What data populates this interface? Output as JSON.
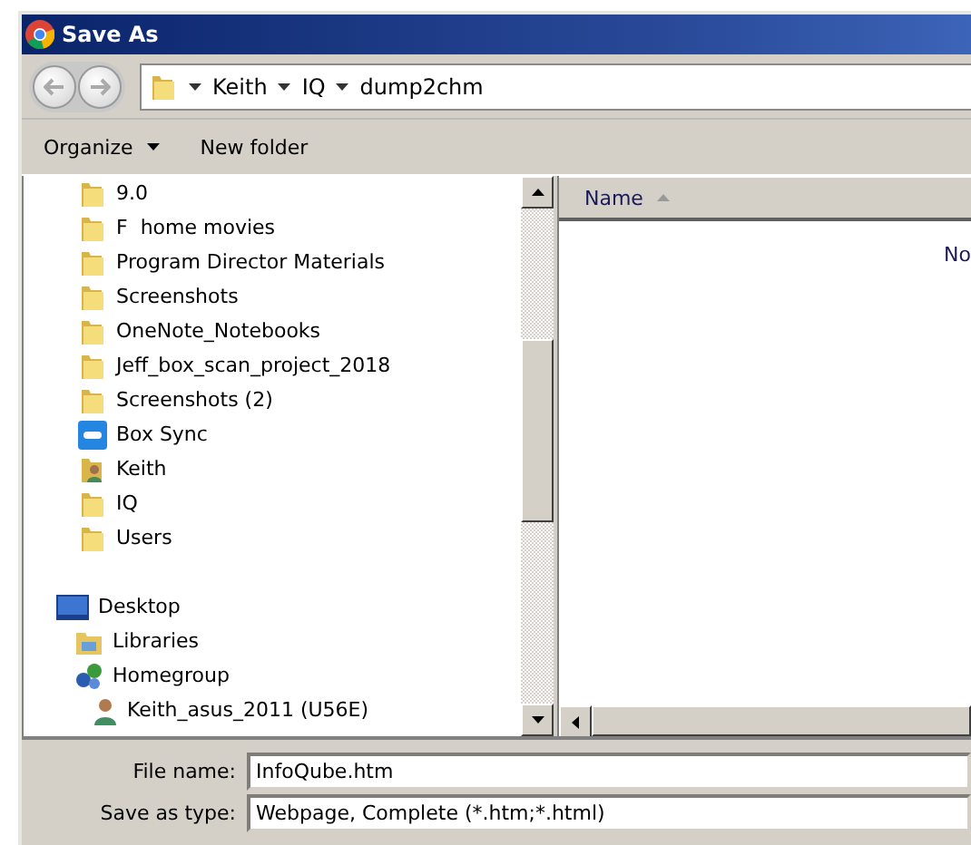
{
  "window": {
    "title": "Save As"
  },
  "address_bar": {
    "crumbs": [
      "Keith",
      "IQ",
      "dump2chm"
    ]
  },
  "toolbar": {
    "organize": "Organize",
    "new_folder": "New folder"
  },
  "nav_pane": {
    "folders": [
      {
        "label": "9.0",
        "kind": "folder"
      },
      {
        "label": "F  home movies",
        "kind": "folder"
      },
      {
        "label": "Program Director Materials",
        "kind": "folder"
      },
      {
        "label": "Screenshots",
        "kind": "folder"
      },
      {
        "label": "OneNote_Notebooks",
        "kind": "folder"
      },
      {
        "label": "Jeff_box_scan_project_2018",
        "kind": "folder"
      },
      {
        "label": "Screenshots (2)",
        "kind": "folder"
      },
      {
        "label": "Box Sync",
        "kind": "box"
      },
      {
        "label": "Keith",
        "kind": "user-folder"
      },
      {
        "label": "IQ",
        "kind": "folder"
      },
      {
        "label": "Users",
        "kind": "folder"
      }
    ],
    "tree": [
      {
        "label": "Desktop",
        "kind": "desktop",
        "children": [
          {
            "label": "Libraries",
            "kind": "libraries"
          },
          {
            "label": "Homegroup",
            "kind": "homegroup",
            "children": [
              {
                "label": "Keith_asus_2011 (U56E)",
                "kind": "user"
              }
            ]
          }
        ]
      }
    ]
  },
  "file_list": {
    "columns": [
      "Name"
    ],
    "empty_message": "No"
  },
  "form": {
    "fields": [
      {
        "label": "File name:",
        "value": "InfoQube.htm"
      },
      {
        "label": "Save as type:",
        "value": "Webpage, Complete (*.htm;*.html)"
      }
    ]
  }
}
